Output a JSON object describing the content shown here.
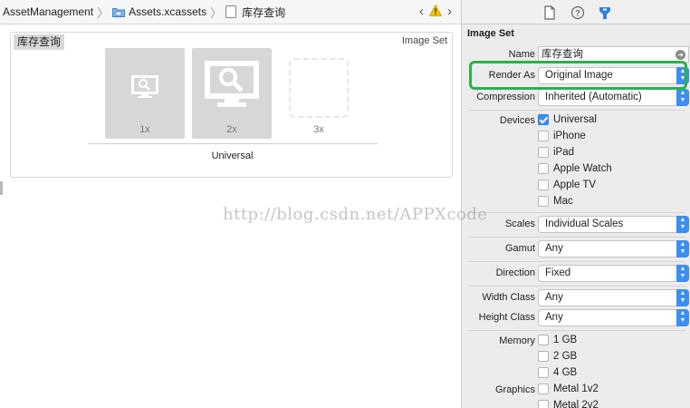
{
  "jumpbar": {
    "project": "AssetManagement",
    "catalog": "Assets.xcassets",
    "asset": "库存查询"
  },
  "asset_panel": {
    "name": "库存查询",
    "kind": "Image Set",
    "slots": [
      {
        "scale": "1x",
        "filled": true
      },
      {
        "scale": "2x",
        "filled": true
      },
      {
        "scale": "3x",
        "filled": false
      }
    ],
    "idiom": "Universal"
  },
  "inspector": {
    "section_title": "Image Set",
    "name_label": "Name",
    "name_value": "库存查询",
    "render_as_label": "Render As",
    "render_as_value": "Original Image",
    "compression_label": "Compression",
    "compression_value": "Inherited (Automatic)",
    "devices_label": "Devices",
    "devices": [
      {
        "label": "Universal",
        "checked": true
      },
      {
        "label": "iPhone",
        "checked": false
      },
      {
        "label": "iPad",
        "checked": false
      },
      {
        "label": "Apple Watch",
        "checked": false
      },
      {
        "label": "Apple TV",
        "checked": false
      },
      {
        "label": "Mac",
        "checked": false
      }
    ],
    "scales_label": "Scales",
    "scales_value": "Individual Scales",
    "gamut_label": "Gamut",
    "gamut_value": "Any",
    "direction_label": "Direction",
    "direction_value": "Fixed",
    "width_class_label": "Width Class",
    "width_class_value": "Any",
    "height_class_label": "Height Class",
    "height_class_value": "Any",
    "memory_label": "Memory",
    "memory": [
      {
        "label": "1 GB",
        "checked": false
      },
      {
        "label": "2 GB",
        "checked": false
      },
      {
        "label": "4 GB",
        "checked": false
      }
    ],
    "graphics_label": "Graphics",
    "graphics": [
      {
        "label": "Metal 1v2",
        "checked": false
      },
      {
        "label": "Metal 2v2",
        "checked": false
      }
    ]
  },
  "watermark": "http://blog.csdn.net/APPXcode",
  "colors": {
    "accent": "#3a8ef6",
    "highlight": "#2bb14a",
    "warning": "#f5c400"
  }
}
